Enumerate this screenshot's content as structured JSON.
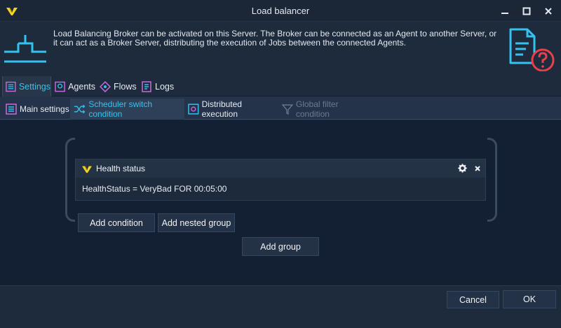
{
  "window": {
    "title": "Load balancer",
    "controls": [
      "minimize",
      "maximize",
      "close"
    ]
  },
  "header": {
    "description": "Load Balancing Broker can be activated on this Server. The Broker can be connected as an Agent to another Server, or it can act as a Broker Server, distributing the execution of Jobs between the connected Agents."
  },
  "main_tabs": [
    {
      "label": "Settings",
      "icon": "settings-icon",
      "active": true
    },
    {
      "label": "Agents",
      "icon": "agents-icon",
      "active": false
    },
    {
      "label": "Flows",
      "icon": "flows-icon",
      "active": false
    },
    {
      "label": "Logs",
      "icon": "logs-icon",
      "active": false
    }
  ],
  "sub_tabs": [
    {
      "label": "Main settings",
      "icon": "main-settings-icon",
      "active": false,
      "enabled": true
    },
    {
      "label": "Scheduler switch condition",
      "icon": "shuffle-icon",
      "active": true,
      "enabled": true
    },
    {
      "label": "Distributed execution",
      "icon": "distributed-icon",
      "active": false,
      "enabled": true
    },
    {
      "label": "Global filter condition",
      "icon": "filter-icon",
      "active": false,
      "enabled": false
    }
  ],
  "condition": {
    "title": "Health status",
    "expression": "HealthStatus = VeryBad FOR 00:05:00"
  },
  "buttons": {
    "add_condition": "Add condition",
    "add_nested_group": "Add nested group",
    "add_group": "Add group",
    "cancel": "Cancel",
    "ok": "OK"
  },
  "colors": {
    "accent": "#34c3ef",
    "logo_yellow": "#f4d51c",
    "help_red": "#e8404a",
    "background": "#132033"
  }
}
